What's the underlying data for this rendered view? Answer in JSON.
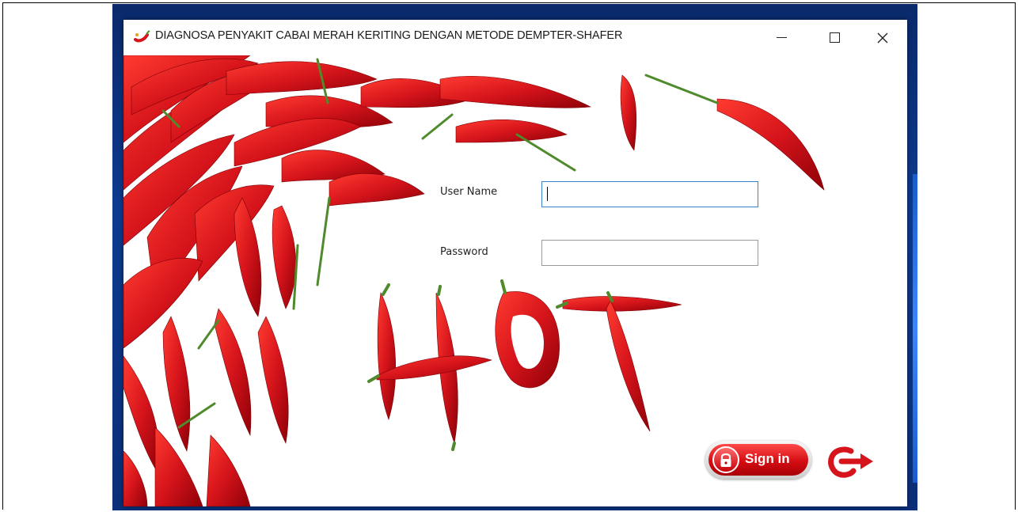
{
  "window": {
    "title": "DIAGNOSA PENYAKIT CABAI MERAH KERITING DENGAN METODE DEMPTER-SHAFER",
    "controls": {
      "minimize": "minimize",
      "maximize": "maximize",
      "close": "close"
    }
  },
  "form": {
    "username_label": "User Name",
    "username_value": "",
    "password_label": "Password",
    "password_value": ""
  },
  "actions": {
    "signin_label": "Sign in",
    "exit_icon": "exit-arrow-icon"
  },
  "background": {
    "word": "HOT",
    "theme": "red chili peppers"
  },
  "colors": {
    "chili_red": "#d5141b",
    "stem_green": "#4f8a2c",
    "desktop_blue": "#0d3b8f",
    "focus_blue": "#3d7fcf"
  }
}
